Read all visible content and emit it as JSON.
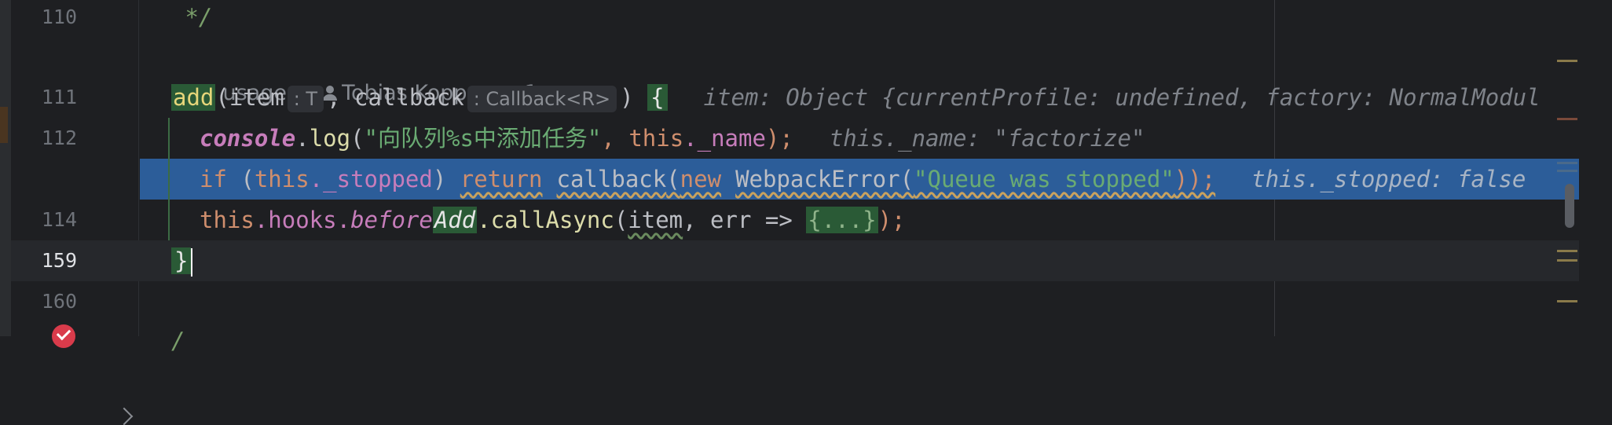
{
  "lines": {
    "l110": {
      "num": "110",
      "text": " */"
    },
    "hints": {
      "usages": "5+ usages",
      "author": "Tobias Koppers +1"
    },
    "l111": {
      "num": "111",
      "fn": "add",
      "p1": "(item",
      "t1": ": T",
      "p2": ", callback",
      "t2": ": Callback<R>",
      "p3": ") ",
      "brace": "{",
      "hint": "item: Object {currentProfile: undefined, factory: NormalModul"
    },
    "l112": {
      "num": "112",
      "console": "console",
      "dot": ".",
      "log": "log",
      "open": "(",
      "str": "\"向队列%s中添加任务\"",
      "comma": ", ",
      "this": "this",
      "name": "._name",
      "close": ");",
      "hint": "this._name: \"factorize\""
    },
    "l113": {
      "if": "if",
      "open": " (",
      "this": "this",
      "stopped": "._stopped",
      "close": ") ",
      "ret": "return",
      "callback": "callback",
      "paren": "(",
      "new": "new",
      "cls": "WebpackError",
      "paren2": "(",
      "str": "\"Queue was stopped\"",
      "end": "));",
      "hint": "this._stopped: false"
    },
    "l114": {
      "num": "114",
      "this": "this",
      "hooks": ".hooks.",
      "before": "before",
      "add": "Add",
      "call": ".callAsync",
      "open": "(",
      "item": "item",
      "rest": ", err => ",
      "folded": "{...}",
      "close": ");"
    },
    "l159": {
      "num": "159",
      "brace": "}"
    },
    "l160": {
      "num": "160"
    },
    "l161": {
      "text": "/"
    }
  }
}
